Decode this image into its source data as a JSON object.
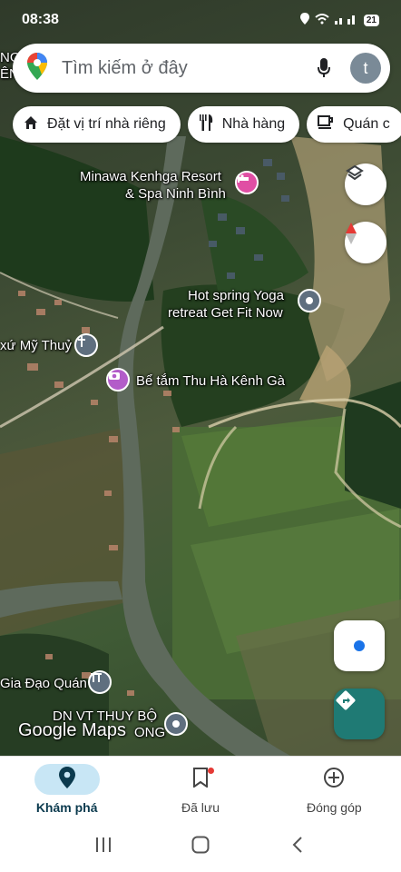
{
  "status_bar": {
    "time": "08:38",
    "battery": "21"
  },
  "search": {
    "placeholder": "Tìm kiếm ở đây",
    "avatar_letter": "t"
  },
  "chips": [
    {
      "label": "Đặt vị trí nhà riêng",
      "icon": "home-icon"
    },
    {
      "label": "Nhà hàng",
      "icon": "restaurant-icon"
    },
    {
      "label": "Quán c",
      "icon": "cafe-icon"
    }
  ],
  "map_labels": {
    "resort_line1": "Minawa Kenhga Resort",
    "resort_line2": "& Spa Ninh Bình",
    "yoga_line1": "Hot spring Yoga",
    "yoga_line2": "retreat Get Fit Now",
    "church": "xứ Mỹ Thuỷ",
    "bath": "Bể tắm Thu Hà Kênh Gà",
    "gia_dao": "Gia Đạo Quán",
    "dn_line1": "DN VT THUY BỘ",
    "dn_line2": "ONG",
    "edge_left_1": "NG",
    "edge_left_2": "ÊN"
  },
  "logo": "Google Maps",
  "bottom_nav": [
    {
      "label": "Khám phá",
      "icon": "explore-pin-icon",
      "active": true
    },
    {
      "label": "Đã lưu",
      "icon": "bookmark-icon",
      "active": false
    },
    {
      "label": "Đóng góp",
      "icon": "add-circle-icon",
      "active": false
    }
  ],
  "colors": {
    "accent": "#c8e6f5",
    "directions": "#1f7a74",
    "resort_pin": "#e04fa4",
    "bath_pin": "#b35cc9",
    "location_dot": "#1a73e8"
  }
}
